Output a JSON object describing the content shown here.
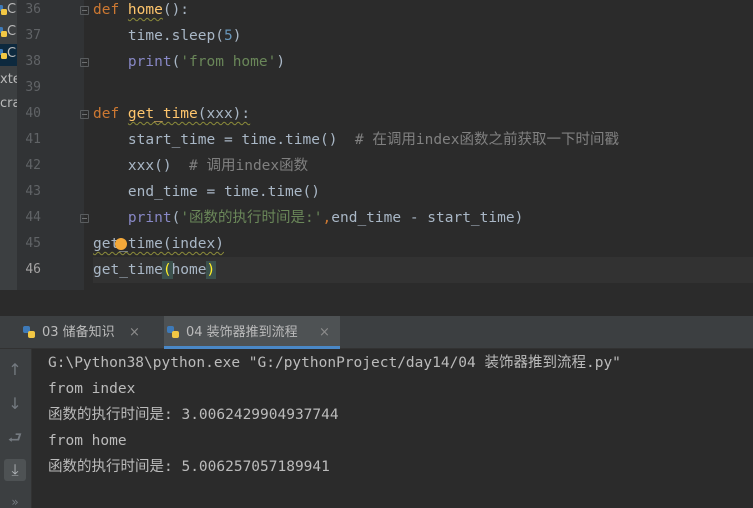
{
  "project_strip": {
    "items": [
      {
        "text": "C",
        "icon": "python-file-icon"
      },
      {
        "text": "C",
        "icon": "python-file-icon"
      },
      {
        "text": "C",
        "icon": "python-file-icon",
        "selected": true
      },
      {
        "text": "xte",
        "icon": ""
      },
      {
        "text": "cra",
        "icon": ""
      }
    ]
  },
  "editor": {
    "line_numbers": [
      "36",
      "37",
      "38",
      "39",
      "40",
      "41",
      "42",
      "43",
      "44",
      "45",
      "46"
    ],
    "current_line": "46",
    "lines": [
      {
        "n": "36",
        "tokens": [
          {
            "t": "def ",
            "c": "kw"
          },
          {
            "t": "home",
            "c": "fn"
          },
          {
            "t": "():",
            "c": ""
          }
        ]
      },
      {
        "n": "37",
        "tokens": [
          {
            "t": "    time.sleep(",
            "c": ""
          },
          {
            "t": "5",
            "c": "num"
          },
          {
            "t": ")",
            "c": ""
          }
        ]
      },
      {
        "n": "38",
        "tokens": [
          {
            "t": "    ",
            "c": ""
          },
          {
            "t": "print",
            "c": "bi"
          },
          {
            "t": "(",
            "c": ""
          },
          {
            "t": "'from home'",
            "c": "str"
          },
          {
            "t": ")",
            "c": ""
          }
        ]
      },
      {
        "n": "39",
        "tokens": []
      },
      {
        "n": "40",
        "tokens": [
          {
            "t": "def ",
            "c": "kw"
          },
          {
            "t": "get_time",
            "c": "fn"
          },
          {
            "t": "(xxx):",
            "c": ""
          }
        ]
      },
      {
        "n": "41",
        "tokens": [
          {
            "t": "    start_time = time.time()  ",
            "c": ""
          },
          {
            "t": "# 在调用index函数之前获取一下时间戳",
            "c": "cmt"
          }
        ]
      },
      {
        "n": "42",
        "tokens": [
          {
            "t": "    xxx()  ",
            "c": ""
          },
          {
            "t": "# 调用index函数",
            "c": "cmt"
          }
        ]
      },
      {
        "n": "43",
        "tokens": [
          {
            "t": "    end_time = time.time()",
            "c": ""
          }
        ]
      },
      {
        "n": "44",
        "tokens": [
          {
            "t": "    ",
            "c": ""
          },
          {
            "t": "print",
            "c": "bi"
          },
          {
            "t": "(",
            "c": ""
          },
          {
            "t": "'函数的执行时间是:'",
            "c": "str"
          },
          {
            "t": ",",
            "c": "kw"
          },
          {
            "t": "end_time - start_time)",
            "c": ""
          }
        ]
      },
      {
        "n": "45",
        "tokens": [
          {
            "t": "get_time(index)",
            "c": ""
          }
        ]
      },
      {
        "n": "46",
        "tokens": [
          {
            "t": "get_time",
            "c": ""
          },
          {
            "t": "(",
            "c": "paren"
          },
          {
            "t": "home",
            "c": ""
          },
          {
            "t": ")",
            "c": "paren"
          }
        ]
      }
    ]
  },
  "run_panel": {
    "tabs": [
      {
        "label": "03 储备知识",
        "close": "×",
        "active": false
      },
      {
        "label": "04 装饰器推到流程",
        "close": "×",
        "active": true
      }
    ],
    "toolbar": {
      "up": "↑",
      "down": "↓",
      "wrap": "⮐",
      "scroll_end": "⤓",
      "more": "»"
    },
    "output": [
      "G:\\Python38\\python.exe \"G:/pythonProject/day14/04 装饰器推到流程.py\"",
      "from index",
      "函数的执行时间是: 3.0062429904937744",
      "from home",
      "函数的执行时间是: 5.006257057189941"
    ]
  },
  "colors": {
    "editor_bg": "#2b2b2b",
    "keyword": "#cc7832",
    "function": "#ffc66d",
    "string": "#6a8759",
    "number": "#6897bb",
    "builtin": "#8888c6",
    "comment": "#808080",
    "tab_active_underline": "#4a88c7"
  }
}
